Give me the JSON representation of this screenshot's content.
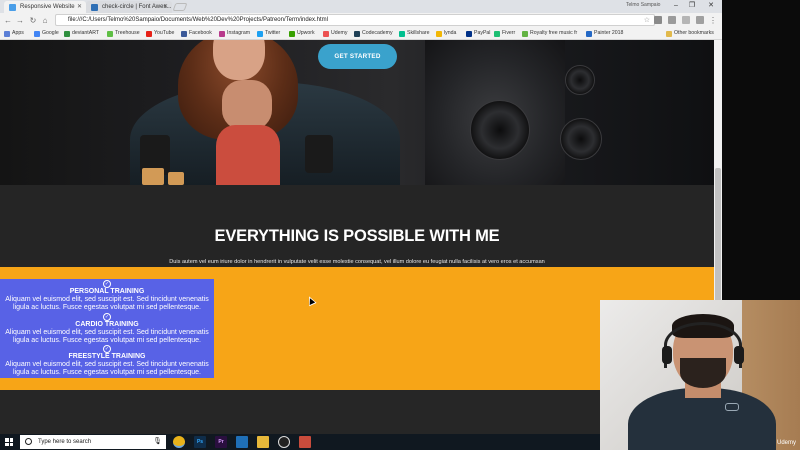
{
  "browser": {
    "tabs": [
      {
        "title": "Responsive Website",
        "active": true,
        "favicon_color": "#4a9ee8"
      },
      {
        "title": "check-circle | Font Awes...",
        "active": false,
        "favicon_color": "#2f6fb5"
      }
    ],
    "address": "file:///C:/Users/Telmo%20Sampaio/Documents/Web%20Dev%20Projects/Patreon/Term/index.html",
    "profile_name": "Telmo Sampaio",
    "bookmarks": [
      {
        "label": "Apps",
        "color": "#5b7fd6"
      },
      {
        "label": "Google",
        "color": "#4285f4"
      },
      {
        "label": "deviantART",
        "color": "#2f8f3e"
      },
      {
        "label": "Treehouse",
        "color": "#5fbf45"
      },
      {
        "label": "YouTube",
        "color": "#e62117"
      },
      {
        "label": "Facebook",
        "color": "#3b5998"
      },
      {
        "label": "Instagram",
        "color": "#b83a8c"
      },
      {
        "label": "Twitter",
        "color": "#1da1f2"
      },
      {
        "label": "Upwork",
        "color": "#37a000"
      },
      {
        "label": "Udemy",
        "color": "#ec5252"
      },
      {
        "label": "Codecademy",
        "color": "#1f4056"
      },
      {
        "label": "Skillshare",
        "color": "#00bf8f"
      },
      {
        "label": "lynda",
        "color": "#f2b705"
      },
      {
        "label": "PayPal",
        "color": "#003087"
      },
      {
        "label": "Fiverr",
        "color": "#1dbf73"
      },
      {
        "label": "Royalty free music fr",
        "color": "#63b343"
      },
      {
        "label": "Painter 2018",
        "color": "#2468c5"
      }
    ],
    "other_bookmarks": "Other bookmarks"
  },
  "page": {
    "cta_label": "GET STARTED",
    "headline": "EVERYTHING IS POSSIBLE WITH ME",
    "subline": "Duis autem vel eum iriure dolor in hendrerit in vulputate velit esse molestie consequat, vel illum dolore eu feugiat nulla facilisis at vero eros et accumsan",
    "services": [
      {
        "title": "PERSONAL TRAINING",
        "desc": "Aliquam vel euismod elit, sed suscipit est. Sed tincidunt venenatis ligula ac luctus. Fusce egestas volutpat mi sed pellentesque."
      },
      {
        "title": "CARDIO TRAINING",
        "desc": "Aliquam vel euismod elit, sed suscipit est. Sed tincidunt venenatis ligula ac luctus. Fusce egestas volutpat mi sed pellentesque."
      },
      {
        "title": "FREESTYLE TRAINING",
        "desc": "Aliquam vel euismod elit, sed suscipit est. Sed tincidunt venenatis ligula ac luctus. Fusce egestas volutpat mi sed pellentesque."
      }
    ],
    "colors": {
      "cta": "#3aa2cc",
      "services_bg": "#5862e6",
      "orange_section": "#f7a517",
      "dark_bg": "#252525"
    }
  },
  "taskbar": {
    "search_placeholder": "Type here to search",
    "apps": [
      {
        "name": "chrome",
        "label": "",
        "color": "#e8b21a"
      },
      {
        "name": "photoshop",
        "label": "Ps",
        "color": "#0f2d4a"
      },
      {
        "name": "premiere",
        "label": "Pr",
        "color": "#2a0f3f"
      },
      {
        "name": "vscode",
        "label": "",
        "color": "#1f6fb7"
      },
      {
        "name": "explorer",
        "label": "",
        "color": "#e7b83a"
      },
      {
        "name": "unity",
        "label": "",
        "color": "#222"
      },
      {
        "name": "paint",
        "label": "",
        "color": "#c94c3c"
      }
    ]
  },
  "webcam": {
    "watermark": "Udemy"
  }
}
